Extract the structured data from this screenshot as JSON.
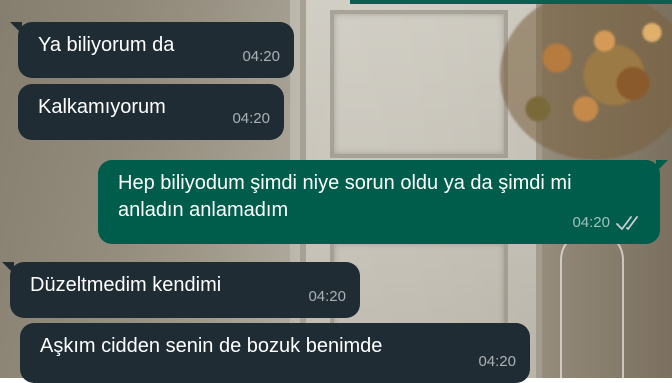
{
  "messages": [
    {
      "direction": "incoming",
      "text": "Ya biliyorum da",
      "time": "04:20"
    },
    {
      "direction": "incoming",
      "text": "Kalkamıyorum",
      "time": "04:20"
    },
    {
      "direction": "outgoing",
      "text": "Hep biliyodum şimdi niye sorun oldu ya da şimdi mi anladın anlamadım",
      "time": "04:20",
      "status": "read",
      "status_icon": "double-check-icon"
    },
    {
      "direction": "incoming",
      "text": "Düzeltmedim kendimi",
      "time": "04:20"
    },
    {
      "direction": "incoming",
      "text": "Aşkım cidden senin de bozuk benimde",
      "time": "04:20"
    }
  ],
  "colors": {
    "incoming_bubble": "#1f2c34",
    "outgoing_bubble": "#005c4b",
    "text": "#ffffff",
    "meta_text": "#a5acb0"
  }
}
